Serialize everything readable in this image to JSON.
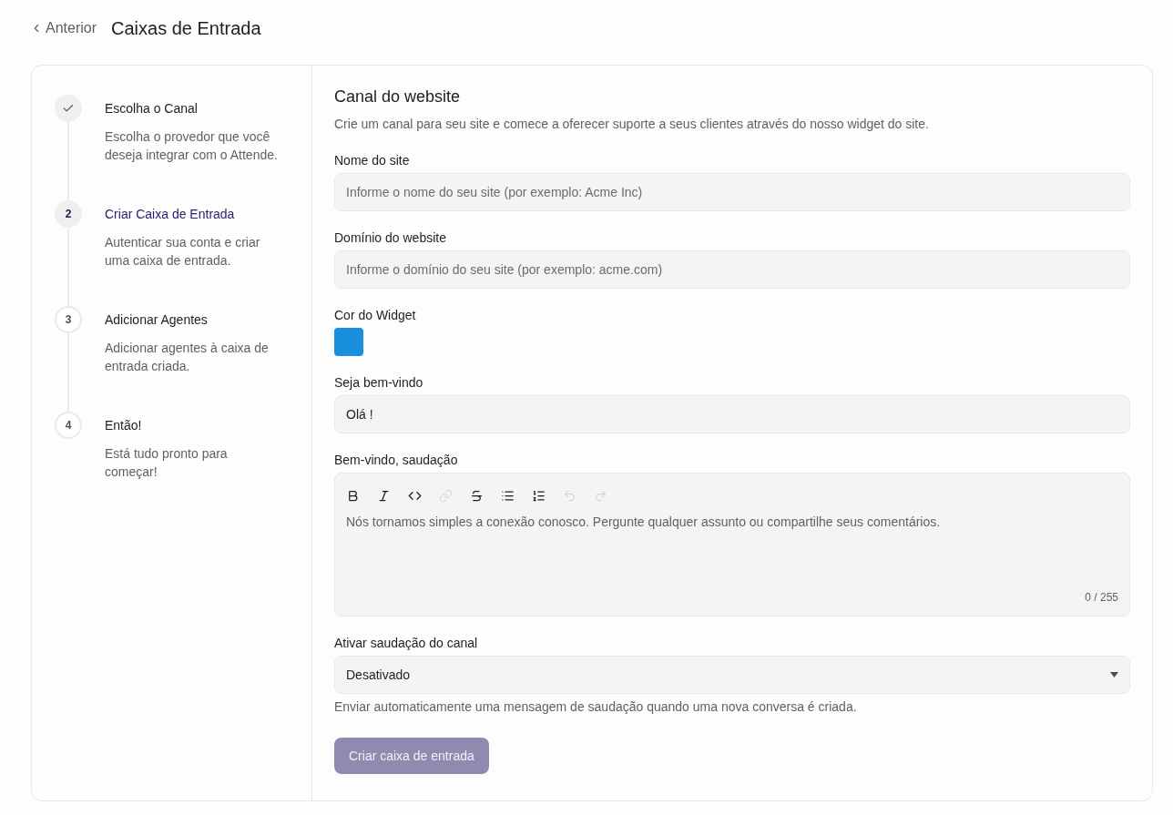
{
  "header": {
    "back": "Anterior",
    "title": "Caixas de Entrada"
  },
  "steps": [
    {
      "title": "Escolha o Canal",
      "description": "Escolha o provedor que você deseja integrar com o Attende.",
      "completed": true,
      "selected": false
    },
    {
      "number": "2",
      "title": "Criar Caixa de Entrada",
      "description": "Autenticar sua conta e criar uma caixa de entrada.",
      "completed": false,
      "selected": true
    },
    {
      "number": "3",
      "title": "Adicionar Agentes",
      "description": "Adicionar agentes à caixa de entrada criada.",
      "completed": false,
      "selected": false
    },
    {
      "number": "4",
      "title": "Então!",
      "description": "Está tudo pronto para começar!",
      "completed": false,
      "selected": false
    }
  ],
  "form": {
    "title": "Canal do website",
    "description": "Crie um canal para seu site e comece a oferecer suporte a seus clientes através do nosso widget do site.",
    "fields": [
      {
        "kind": "text",
        "label": "Nome do site",
        "placeholder": "Informe o nome do seu site (por exemplo: Acme Inc)"
      },
      {
        "kind": "text",
        "label": "Domínio do website",
        "placeholder": "Informe o domínio do seu site (por exemplo: acme.com)"
      },
      {
        "kind": "color",
        "label": "Cor do Widget",
        "color": "#1a8fdd"
      },
      {
        "kind": "text",
        "label": "Seja bem-vindo",
        "value": "Olá !"
      },
      {
        "kind": "editor",
        "label": "Bem-vindo, saudação",
        "toolbar": [
          {
            "kind": "bold",
            "disabled": false
          },
          {
            "kind": "italic",
            "disabled": false
          },
          {
            "kind": "code",
            "disabled": false
          },
          {
            "kind": "link",
            "disabled": true
          },
          {
            "kind": "strikethrough",
            "disabled": false
          },
          {
            "kind": "bullet_list",
            "disabled": false
          },
          {
            "kind": "ordered_list",
            "disabled": false
          },
          {
            "kind": "undo",
            "disabled": true
          },
          {
            "kind": "redo",
            "disabled": true
          }
        ],
        "placeholder": "Nós tornamos simples a conexão conosco. Pergunte qualquer assunto ou compartilhe seus comentários.",
        "counter": "0 / 255"
      },
      {
        "kind": "select",
        "label": "Ativar saudação do canal",
        "value": "Desativado",
        "help": "Enviar automaticamente uma mensagem de saudação quando uma nova conversa é criada."
      }
    ],
    "submit": {
      "label": "Criar caixa de entrada",
      "disabled": true
    }
  }
}
